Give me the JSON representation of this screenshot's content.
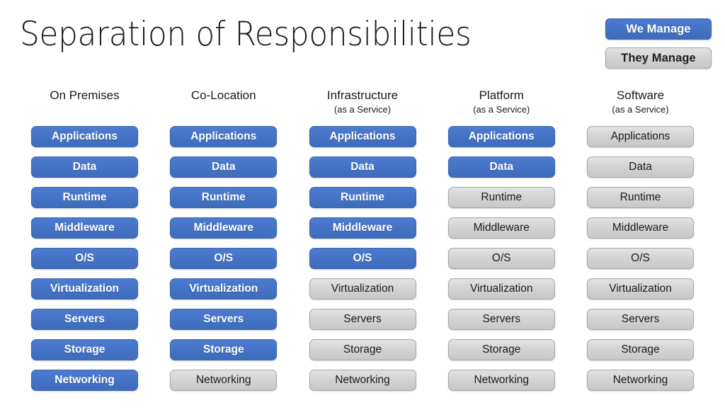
{
  "slide": {
    "title": "Separation of Responsibilities"
  },
  "legend": {
    "we_manage": "We Manage",
    "they_manage": "They Manage",
    "we_manage_color": "#4472C4",
    "they_manage_color": "#D4D4D4"
  },
  "layers": [
    "Applications",
    "Data",
    "Runtime",
    "Middleware",
    "O/S",
    "Virtualization",
    "Servers",
    "Storage",
    "Networking"
  ],
  "columns": [
    {
      "title": "On Premises",
      "subtitle": "",
      "cells": [
        {
          "label": "Applications",
          "owner": "we"
        },
        {
          "label": "Data",
          "owner": "we"
        },
        {
          "label": "Runtime",
          "owner": "we"
        },
        {
          "label": "Middleware",
          "owner": "we"
        },
        {
          "label": "O/S",
          "owner": "we"
        },
        {
          "label": "Virtualization",
          "owner": "we"
        },
        {
          "label": "Servers",
          "owner": "we"
        },
        {
          "label": "Storage",
          "owner": "we"
        },
        {
          "label": "Networking",
          "owner": "we"
        }
      ]
    },
    {
      "title": "Co-Location",
      "subtitle": "",
      "cells": [
        {
          "label": "Applications",
          "owner": "we"
        },
        {
          "label": "Data",
          "owner": "we"
        },
        {
          "label": "Runtime",
          "owner": "we"
        },
        {
          "label": "Middleware",
          "owner": "we"
        },
        {
          "label": "O/S",
          "owner": "we"
        },
        {
          "label": "Virtualization",
          "owner": "we"
        },
        {
          "label": "Servers",
          "owner": "we"
        },
        {
          "label": "Storage",
          "owner": "we"
        },
        {
          "label": "Networking",
          "owner": "they"
        }
      ]
    },
    {
      "title": "Infrastructure",
      "subtitle": "(as a Service)",
      "cells": [
        {
          "label": "Applications",
          "owner": "we"
        },
        {
          "label": "Data",
          "owner": "we"
        },
        {
          "label": "Runtime",
          "owner": "we"
        },
        {
          "label": "Middleware",
          "owner": "we"
        },
        {
          "label": "O/S",
          "owner": "we"
        },
        {
          "label": "Virtualization",
          "owner": "they"
        },
        {
          "label": "Servers",
          "owner": "they"
        },
        {
          "label": "Storage",
          "owner": "they"
        },
        {
          "label": "Networking",
          "owner": "they"
        }
      ]
    },
    {
      "title": "Platform",
      "subtitle": "(as a Service)",
      "cells": [
        {
          "label": "Applications",
          "owner": "we"
        },
        {
          "label": "Data",
          "owner": "we"
        },
        {
          "label": "Runtime",
          "owner": "they"
        },
        {
          "label": "Middleware",
          "owner": "they"
        },
        {
          "label": "O/S",
          "owner": "they"
        },
        {
          "label": "Virtualization",
          "owner": "they"
        },
        {
          "label": "Servers",
          "owner": "they"
        },
        {
          "label": "Storage",
          "owner": "they"
        },
        {
          "label": "Networking",
          "owner": "they"
        }
      ]
    },
    {
      "title": "Software",
      "subtitle": "(as a Service)",
      "cells": [
        {
          "label": "Applications",
          "owner": "they"
        },
        {
          "label": "Data",
          "owner": "they"
        },
        {
          "label": "Runtime",
          "owner": "they"
        },
        {
          "label": "Middleware",
          "owner": "they"
        },
        {
          "label": "O/S",
          "owner": "they"
        },
        {
          "label": "Virtualization",
          "owner": "they"
        },
        {
          "label": "Servers",
          "owner": "they"
        },
        {
          "label": "Storage",
          "owner": "they"
        },
        {
          "label": "Networking",
          "owner": "they"
        }
      ]
    }
  ]
}
